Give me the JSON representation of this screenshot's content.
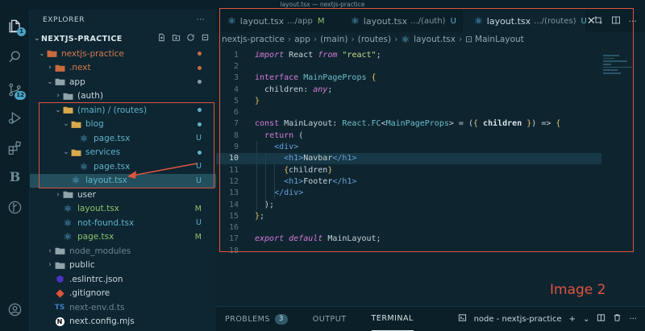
{
  "window_title": "layout.tsx — nextjs-practice",
  "activity_bar": {
    "items": [
      {
        "icon": "files-icon",
        "badge": "1"
      },
      {
        "icon": "search-icon",
        "badge": ""
      },
      {
        "icon": "source-control-icon",
        "badge": "12"
      },
      {
        "icon": "run-debug-icon",
        "badge": ""
      },
      {
        "icon": "extensions-icon",
        "badge": ""
      },
      {
        "icon": "b-extension-icon",
        "badge": "",
        "letter": "B"
      },
      {
        "icon": "git-graph-icon",
        "badge": ""
      },
      {
        "icon": "account-icon",
        "badge": ""
      },
      {
        "icon": "settings-gear-icon",
        "badge": ""
      }
    ]
  },
  "explorer": {
    "title": "EXPLORER",
    "more": "···",
    "project": "NEXTJS-PRACTICE",
    "tree": [
      {
        "name": "nextjs-practice",
        "type": "folder-open",
        "depth": 1,
        "status": "dot",
        "color": "orange",
        "chev": "⌄"
      },
      {
        "name": ".next",
        "type": "folder",
        "depth": 2,
        "status": "dot",
        "color": "orange",
        "chev": "›"
      },
      {
        "name": "app",
        "type": "folder-open",
        "depth": 2,
        "status": "dot",
        "color": "plain",
        "chev": "⌄"
      },
      {
        "name": "(auth)",
        "type": "folder",
        "depth": 3,
        "status": "",
        "color": "plain",
        "chev": "›"
      },
      {
        "name": "(main) / (routes)",
        "type": "folder-open",
        "depth": 3,
        "status": "dot",
        "color": "untracked",
        "chev": "⌄"
      },
      {
        "name": "blog",
        "type": "folder-open",
        "depth": 4,
        "status": "dot",
        "color": "untracked",
        "chev": "⌄"
      },
      {
        "name": "page.tsx",
        "type": "react",
        "depth": 5,
        "status": "U",
        "color": "untracked",
        "chev": ""
      },
      {
        "name": "services",
        "type": "folder-open",
        "depth": 4,
        "status": "dot",
        "color": "untracked",
        "chev": "⌄"
      },
      {
        "name": "page.tsx",
        "type": "react",
        "depth": 5,
        "status": "U",
        "color": "untracked",
        "chev": ""
      },
      {
        "name": "layout.tsx",
        "type": "react",
        "depth": 4,
        "status": "U",
        "color": "untracked",
        "chev": "",
        "selected": true
      },
      {
        "name": "user",
        "type": "folder",
        "depth": 3,
        "status": "",
        "color": "plain",
        "chev": "›"
      },
      {
        "name": "layout.tsx",
        "type": "react",
        "depth": 3,
        "status": "M",
        "color": "modified",
        "chev": ""
      },
      {
        "name": "not-found.tsx",
        "type": "react",
        "depth": 3,
        "status": "U",
        "color": "untracked",
        "chev": ""
      },
      {
        "name": "page.tsx",
        "type": "react",
        "depth": 3,
        "status": "M",
        "color": "modified",
        "chev": ""
      },
      {
        "name": "node_modules",
        "type": "folder",
        "depth": 2,
        "status": "",
        "color": "dim",
        "chev": "›"
      },
      {
        "name": "public",
        "type": "folder",
        "depth": 2,
        "status": "",
        "color": "plain",
        "chev": "›"
      },
      {
        "name": ".eslintrc.json",
        "type": "eslint",
        "depth": 2,
        "status": "",
        "color": "plain",
        "chev": ""
      },
      {
        "name": ".gitignore",
        "type": "git",
        "depth": 2,
        "status": "",
        "color": "plain",
        "chev": ""
      },
      {
        "name": "next-env.d.ts",
        "type": "ts",
        "depth": 2,
        "status": "",
        "color": "dim",
        "chev": ""
      },
      {
        "name": "next.config.mjs",
        "type": "next",
        "depth": 2,
        "status": "",
        "color": "plain",
        "chev": ""
      }
    ]
  },
  "tabs": [
    {
      "name": "layout.tsx",
      "desc": ".../app",
      "status": "M",
      "status_color": "modified",
      "active": false
    },
    {
      "name": "layout.tsx",
      "desc": ".../(auth)",
      "status": "U",
      "status_color": "untracked",
      "active": false
    },
    {
      "name": "layout.tsx",
      "desc": ".../(routes)",
      "status": "U",
      "status_color": "untracked",
      "active": true,
      "close": "✕"
    }
  ],
  "breadcrumb": [
    "nextjs-practice",
    "app",
    "(main)",
    "(routes)",
    "layout.tsx",
    "MainLayout"
  ],
  "editor": {
    "current_line": 10,
    "lines": [
      {
        "n": "1",
        "html": "<span class=\"k\">import</span> React <span class=\"k\">from</span> <span class=\"s\">\"react\"</span>;"
      },
      {
        "n": "2",
        "html": ""
      },
      {
        "n": "3",
        "html": "<span class=\"k2\">interface</span> <span class=\"t\">MainPageProps</span> <span class=\"br\">{</span>"
      },
      {
        "n": "4",
        "html": "  children: <span class=\"k\">any</span>;"
      },
      {
        "n": "5",
        "html": "<span class=\"br\">}</span>"
      },
      {
        "n": "6",
        "html": ""
      },
      {
        "n": "7",
        "html": "<span class=\"k2\">const</span> MainLayout: <span class=\"t\">React.FC</span>&lt;<span class=\"t\">MainPageProps</span>&gt; = (<span class=\"br\">{</span> <span class=\"bo\">children</span> <span class=\"br\">}</span>) =&gt; <span class=\"br\">{</span>"
      },
      {
        "n": "8",
        "html": "  <span class=\"k2\">return</span> ("
      },
      {
        "n": "9",
        "html": "    <span class=\"tag\">&lt;div&gt;</span>"
      },
      {
        "n": "10",
        "html": "      <span class=\"tag\">&lt;h1&gt;</span>Navbar<span class=\"tag\">&lt;/h1&gt;</span>"
      },
      {
        "n": "11",
        "html": "      <span class=\"br\">{</span>children<span class=\"br\">}</span>"
      },
      {
        "n": "12",
        "html": "      <span class=\"tag\">&lt;h1&gt;</span>Footer<span class=\"tag\">&lt;/h1&gt;</span>"
      },
      {
        "n": "13",
        "html": "    <span class=\"tag\">&lt;/div&gt;</span>"
      },
      {
        "n": "14",
        "html": "  );"
      },
      {
        "n": "15",
        "html": "<span class=\"br\">}</span>;"
      },
      {
        "n": "16",
        "html": ""
      },
      {
        "n": "17",
        "html": "<span class=\"k\">export</span> <span class=\"k\">default</span> MainLayout;"
      },
      {
        "n": "18",
        "html": ""
      }
    ]
  },
  "panel": {
    "tabs": [
      {
        "label": "PROBLEMS",
        "badge": "3",
        "active": false
      },
      {
        "label": "OUTPUT",
        "badge": "",
        "active": false
      },
      {
        "label": "TERMINAL",
        "badge": "",
        "active": true
      }
    ],
    "terminal_name": "node - nextjs-practice",
    "more": "···"
  },
  "annotation": {
    "label": "Image 2",
    "color": "#e0533f"
  }
}
